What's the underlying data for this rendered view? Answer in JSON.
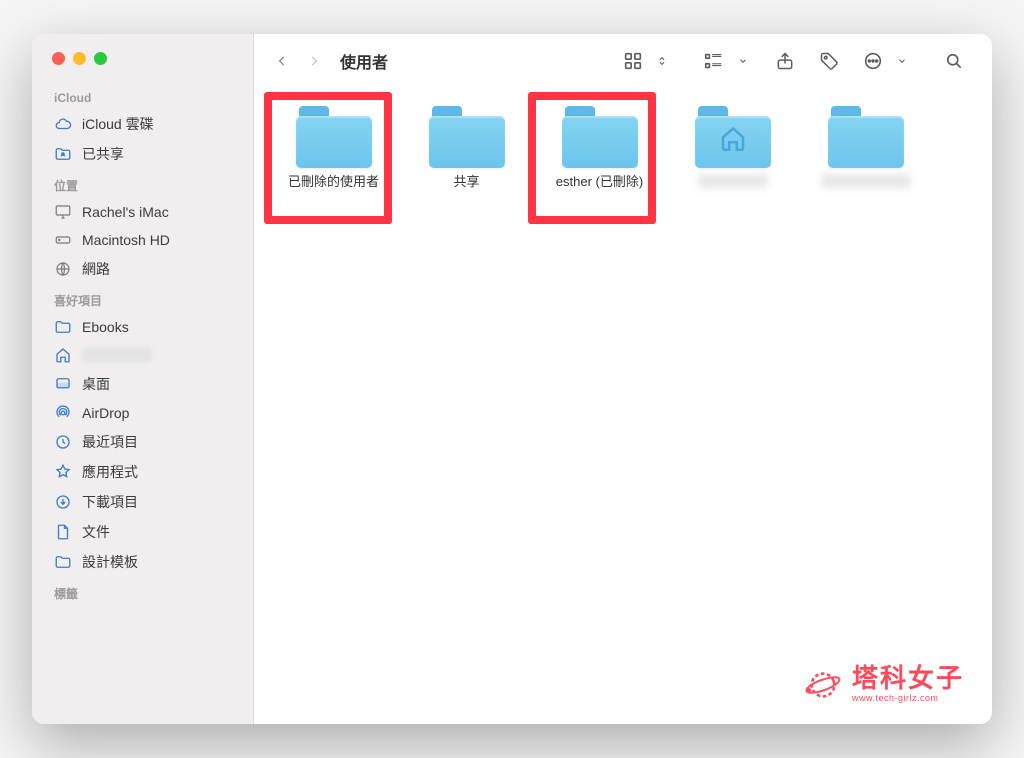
{
  "window": {
    "title": "使用者"
  },
  "sidebar": {
    "sections": [
      {
        "header": "iCloud",
        "items": [
          {
            "icon": "cloud",
            "label": "iCloud 雲碟"
          },
          {
            "icon": "shared-folder",
            "label": "已共享"
          }
        ]
      },
      {
        "header": "位置",
        "items": [
          {
            "icon": "imac",
            "label": "Rachel's iMac",
            "iconColor": "gray"
          },
          {
            "icon": "hdd",
            "label": "Macintosh HD",
            "iconColor": "gray"
          },
          {
            "icon": "network",
            "label": "網路",
            "iconColor": "gray"
          }
        ]
      },
      {
        "header": "喜好項目",
        "items": [
          {
            "icon": "folder-plain",
            "label": "Ebooks"
          },
          {
            "icon": "home",
            "label": "",
            "blurred": true
          },
          {
            "icon": "desktop",
            "label": "桌面"
          },
          {
            "icon": "airdrop",
            "label": "AirDrop"
          },
          {
            "icon": "clock",
            "label": "最近項目"
          },
          {
            "icon": "apps",
            "label": "應用程式"
          },
          {
            "icon": "download",
            "label": "下載項目"
          },
          {
            "icon": "document",
            "label": "文件"
          },
          {
            "icon": "folder-plain",
            "label": "設計模板"
          }
        ]
      },
      {
        "header": "標籤",
        "items": []
      }
    ]
  },
  "folders": [
    {
      "label": "已刪除的使用者",
      "highlight": true
    },
    {
      "label": "共享"
    },
    {
      "label": "esther (已刪除)",
      "highlight": true
    },
    {
      "label": "",
      "blurred": true,
      "home": true
    },
    {
      "label": "",
      "blurred": true
    }
  ],
  "watermark": {
    "zh": "塔科女子",
    "en": "www.tech-girlz.com"
  }
}
